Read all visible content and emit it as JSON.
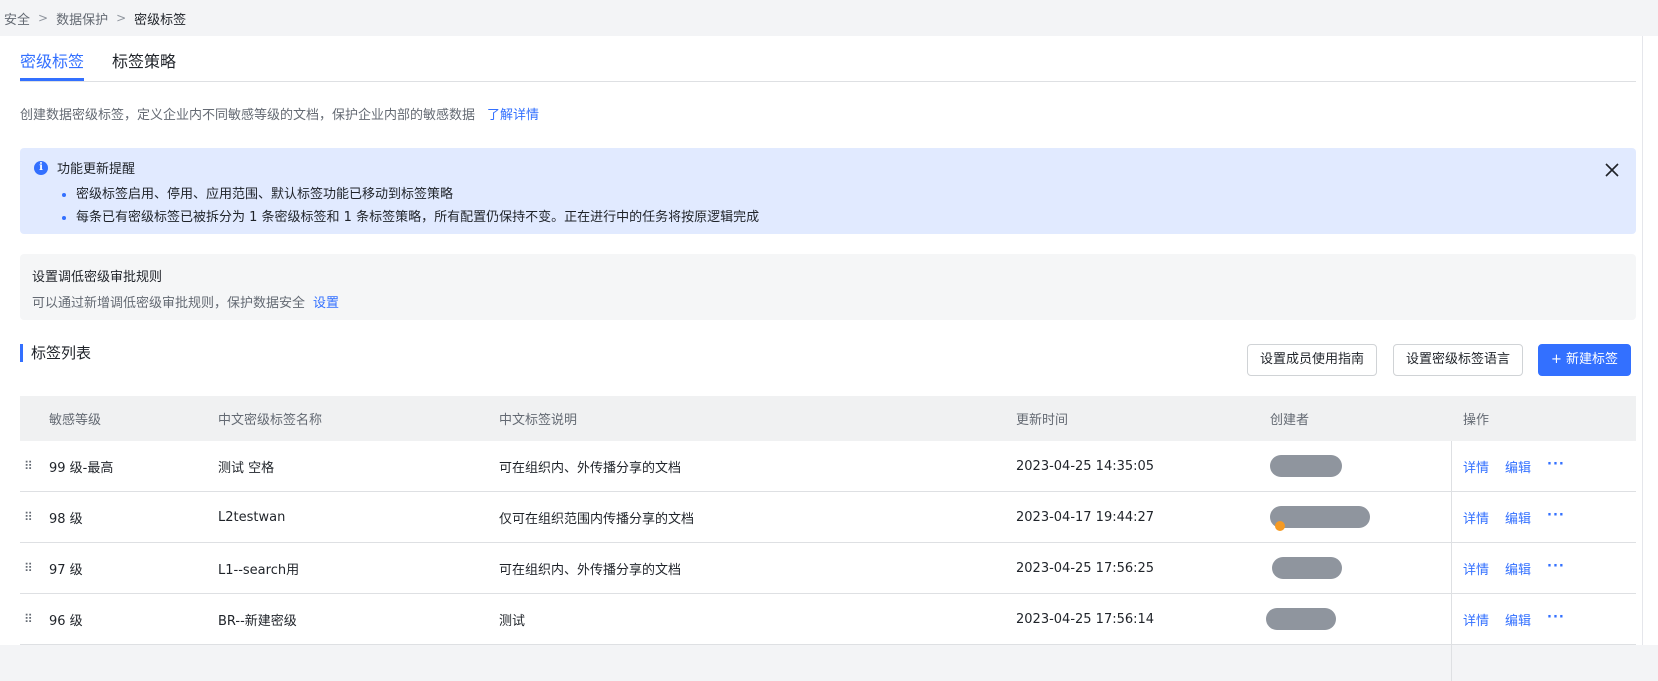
{
  "breadcrumb": [
    "安全",
    "数据保护",
    "密级标签"
  ],
  "tabs": [
    {
      "label": "密级标签",
      "active": true
    },
    {
      "label": "标签策略",
      "active": false
    }
  ],
  "description": {
    "text": "创建数据密级标签，定义企业内不同敏感等级的文档，保护企业内部的敏感数据",
    "link": "了解详情"
  },
  "notice": {
    "title": "功能更新提醒",
    "items": [
      "密级标签启用、停用、应用范围、默认标签功能已移动到标签策略",
      "每条已有密级标签已被拆分为 1 条密级标签和 1 条标签策略，所有配置仍保持不变。正在进行中的任务将按原逻辑完成"
    ]
  },
  "approval": {
    "title": "设置调低密级审批规则",
    "text": "可以通过新增调低密级审批规则，保护数据安全",
    "link": "设置"
  },
  "list": {
    "title": "标签列表",
    "buttons": {
      "guide": "设置成员使用指南",
      "language": "设置密级标签语言",
      "create": "新建标签",
      "create_icon": "+"
    },
    "columns": {
      "level": "敏感等级",
      "name": "中文密级标签名称",
      "desc": "中文标签说明",
      "time": "更新时间",
      "creator": "创建者",
      "ops": "操作"
    },
    "drag_glyph": "⠿",
    "op_labels": {
      "detail": "详情",
      "edit": "编辑",
      "more": "···"
    },
    "rows": [
      {
        "level": "99 级-最高",
        "name": "测试 空格",
        "desc": "可在组织内、外传播分享的文档",
        "time": "2023-04-25 14:35:05"
      },
      {
        "level": "98 级",
        "name": "L2testwan",
        "desc": "仅可在组织范围内传播分享的文档",
        "time": "2023-04-17 19:44:27"
      },
      {
        "level": "97 级",
        "name": "L1--search用",
        "desc": "可在组织内、外传播分享的文档",
        "time": "2023-04-25 17:56:25"
      },
      {
        "level": "96 级",
        "name": "BR--新建密级",
        "desc": "测试",
        "time": "2023-04-25 17:56:14"
      }
    ]
  },
  "colors": {
    "accent": "#3370ff",
    "notice_bg": "#e1eaff",
    "redacted": "#8f959e"
  }
}
